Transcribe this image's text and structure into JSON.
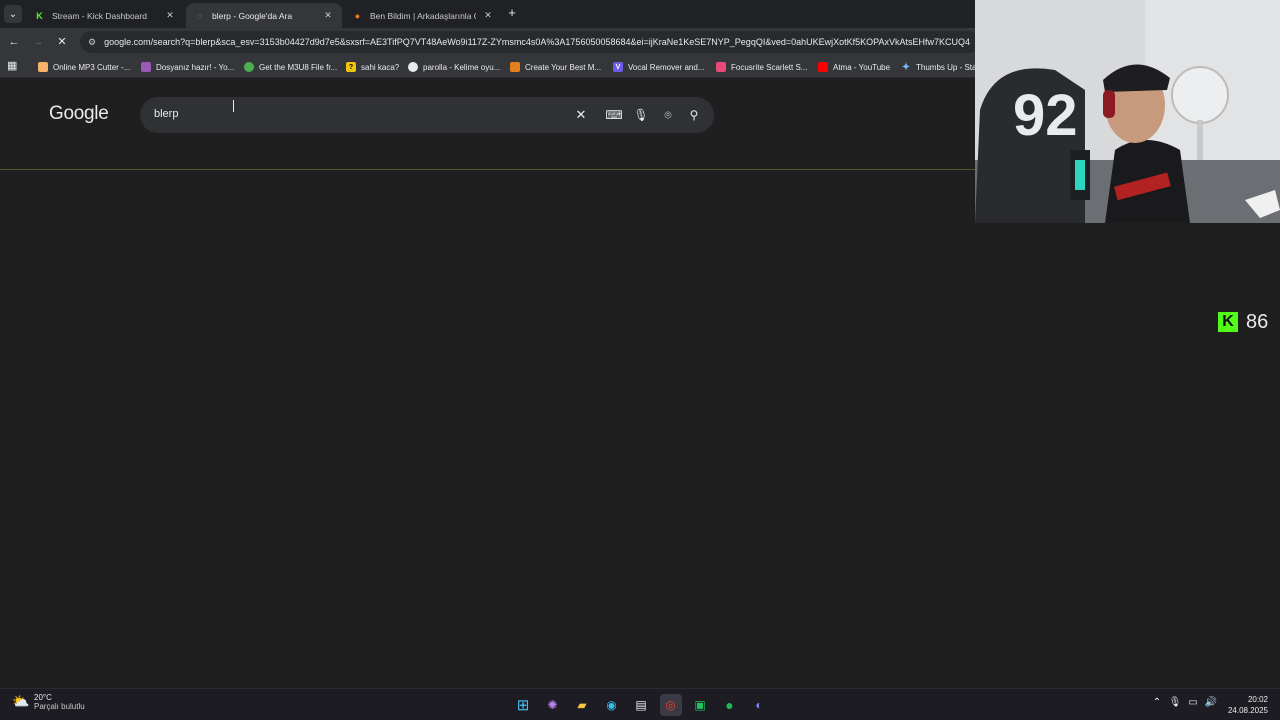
{
  "tabs": [
    {
      "title": "Stream - Kick Dashboard",
      "icon": "kick-icon",
      "active": false
    },
    {
      "title": "blerp - Google'da Ara",
      "icon": "google-loading-icon",
      "active": true
    },
    {
      "title": "Ben Bildim | Arkadaşlarınla Onli",
      "icon": "benbildim-icon",
      "active": false
    }
  ],
  "omnibox": {
    "url": "google.com/search?q=blerp&sca_esv=3153b04427d9d7e5&sxsrf=AE3TifPQ7VT48AeWo9i117Z-ZYmsmc4s0A%3A1756050058684&ei=ijKraNe1KeSE7NYP_PegqQI&ved=0ahUKEwjXotKf5KOPAxVkAtsEHfw7KCUQ4"
  },
  "bookmarks": [
    {
      "label": "Online MP3 Cutter -...",
      "color": "#f6b26b"
    },
    {
      "label": "Dosyanız hazır! - Yo...",
      "color": "#9b59b6"
    },
    {
      "label": "Get the M3U8 File fr...",
      "color": "#4caf50"
    },
    {
      "label": "sahi kaca?",
      "color": "#f1c40f"
    },
    {
      "label": "parolla - Kelime oyu...",
      "color": "#e8eaed"
    },
    {
      "label": "Create Your Best M...",
      "color": "#e67e22"
    },
    {
      "label": "Vocal Remover and...",
      "color": "#6c5ce7"
    },
    {
      "label": "Focusrite Scarlett S...",
      "color": "#e84a7a"
    },
    {
      "label": "Atma - YouTube",
      "color": "#ff0000"
    },
    {
      "label": "Thumbs Up - Sta",
      "color": "#74b9ff"
    }
  ],
  "search": {
    "logo": "Google",
    "query": "blerp"
  },
  "overlay": {
    "kick_count": "86"
  },
  "weather": {
    "temp": "20°C",
    "condition": "Parçalı bulutlu"
  },
  "clock": {
    "time": "20:02",
    "date": "24.08.2025"
  }
}
